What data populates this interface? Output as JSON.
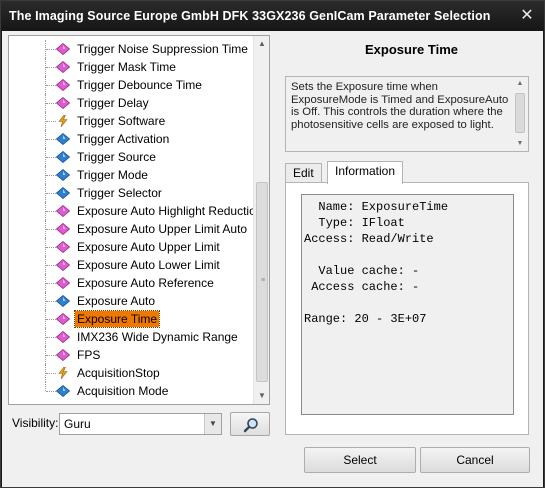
{
  "window": {
    "title": "The Imaging Source Europe GmbH DFK 33GX236 GenICam Parameter Selection"
  },
  "tree": {
    "items": [
      {
        "label": "Trigger Noise Suppression Time",
        "icon": "float-icon",
        "selected": false
      },
      {
        "label": "Trigger Mask Time",
        "icon": "float-icon",
        "selected": false
      },
      {
        "label": "Trigger Debounce Time",
        "icon": "float-icon",
        "selected": false
      },
      {
        "label": "Trigger Delay",
        "icon": "float-icon",
        "selected": false
      },
      {
        "label": "Trigger Software",
        "icon": "command-icon",
        "selected": false
      },
      {
        "label": "Trigger Activation",
        "icon": "enum-icon",
        "selected": false
      },
      {
        "label": "Trigger Source",
        "icon": "enum-icon",
        "selected": false
      },
      {
        "label": "Trigger Mode",
        "icon": "enum-icon",
        "selected": false
      },
      {
        "label": "Trigger Selector",
        "icon": "enum-icon",
        "selected": false
      },
      {
        "label": "Exposure Auto Highlight Reduction",
        "icon": "boolean-icon",
        "selected": false
      },
      {
        "label": "Exposure Auto Upper Limit Auto",
        "icon": "boolean-icon",
        "selected": false
      },
      {
        "label": "Exposure Auto Upper Limit",
        "icon": "float-icon",
        "selected": false
      },
      {
        "label": "Exposure Auto Lower Limit",
        "icon": "float-icon",
        "selected": false
      },
      {
        "label": "Exposure Auto Reference",
        "icon": "integer-icon",
        "selected": false
      },
      {
        "label": "Exposure Auto",
        "icon": "enum-icon",
        "selected": false
      },
      {
        "label": "Exposure Time",
        "icon": "float-icon",
        "selected": true
      },
      {
        "label": "IMX236 Wide Dynamic Range",
        "icon": "boolean-icon",
        "selected": false
      },
      {
        "label": "FPS",
        "icon": "float-icon",
        "selected": false
      },
      {
        "label": "AcquisitionStop",
        "icon": "command-icon",
        "selected": false
      },
      {
        "label": "Acquisition Mode",
        "icon": "enum-icon",
        "selected": false
      }
    ]
  },
  "visibility": {
    "label": "Visibility:",
    "value": "Guru"
  },
  "detail": {
    "title": "Exposure Time",
    "description": "Sets the Exposure time when ExposureMode is Timed and ExposureAuto is Off. This controls the duration where the photosensitive cells are exposed to light.",
    "tabs": [
      "Edit",
      "Information"
    ],
    "active_tab": "Information",
    "info": {
      "name": "  Name: ExposureTime",
      "type": "  Type: IFloat",
      "access": "Access: Read/Write",
      "value_cache": "  Value cache: -",
      "access_cache": " Access cache: -",
      "range": "Range: 20 - 3E+07"
    }
  },
  "buttons": {
    "select": "Select",
    "cancel": "Cancel"
  },
  "colors": {
    "selection": "#f07800",
    "float_icon": "#e05ad0",
    "enum_icon": "#2e7fd0",
    "command_icon": "#e0a020",
    "titlebar": "#161616"
  }
}
